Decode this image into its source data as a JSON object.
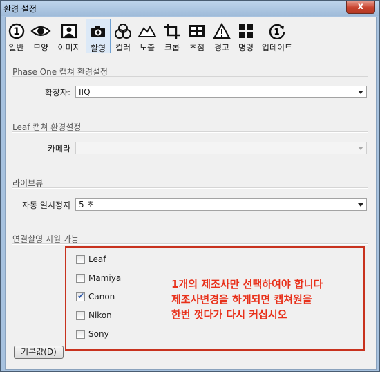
{
  "window": {
    "title": "환경 설정",
    "close_label": "x"
  },
  "toolbar": {
    "items": [
      {
        "label": "일반"
      },
      {
        "label": "모양"
      },
      {
        "label": "이미지"
      },
      {
        "label": "촬영"
      },
      {
        "label": "컬러"
      },
      {
        "label": "노출"
      },
      {
        "label": "크롭"
      },
      {
        "label": "초점"
      },
      {
        "label": "경고"
      },
      {
        "label": "명령"
      },
      {
        "label": "업데이트"
      }
    ],
    "active": "촬영"
  },
  "phaseone": {
    "header": "Phase One 캡쳐 환경설정",
    "ext_label": "확장자:",
    "ext_value": "IIQ"
  },
  "leaf": {
    "header": "Leaf 캡쳐 환경설정",
    "camera_label": "카메라",
    "camera_value": ""
  },
  "liveview": {
    "header": "라이브뷰",
    "pause_label": "자동 일시정지",
    "pause_value": "5 초"
  },
  "tethered": {
    "header": "연결촬영 지원 가능",
    "options": [
      {
        "label": "Leaf",
        "checked": false
      },
      {
        "label": "Mamiya",
        "checked": false
      },
      {
        "label": "Canon",
        "checked": true
      },
      {
        "label": "Nikon",
        "checked": false
      },
      {
        "label": "Sony",
        "checked": false
      }
    ],
    "check_mark": "✔"
  },
  "annotation": {
    "lines": [
      "1개의 제조사만 선택하여야 합니다",
      "제조사변경을 하게되면 캡쳐원을",
      "한번 껏다가 다시 커십시오"
    ],
    "color": "#e8301a"
  },
  "defaults_button": "기본값(D)"
}
